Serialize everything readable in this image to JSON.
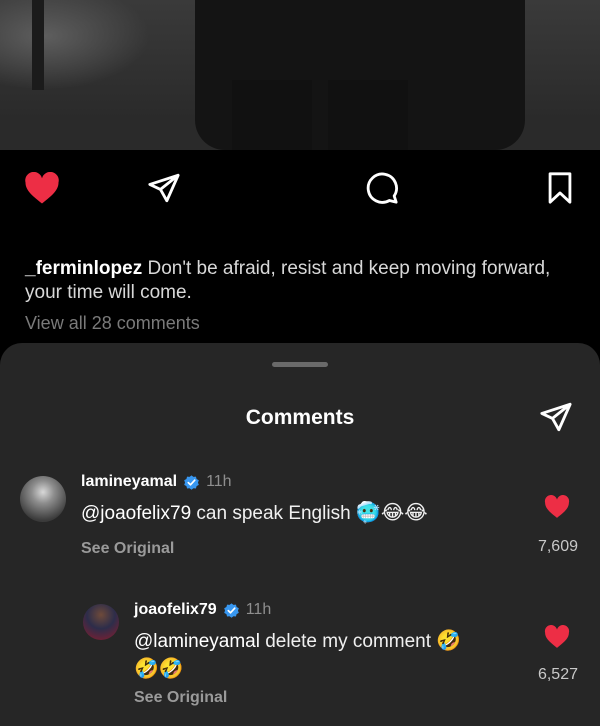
{
  "post": {
    "caption_user": "_ferminlopez",
    "caption_text": "Don't be afraid, resist and keep moving forward, your time will come.",
    "view_all_comments": "View all 28 comments"
  },
  "sheet": {
    "title": "Comments"
  },
  "comments": [
    {
      "username": "lamineyamal",
      "time": "11h",
      "mention": "@joaofelix79",
      "text": "can speak English",
      "emojis": "🥶😂😂",
      "see_original": "See Original",
      "likes": "7,609"
    },
    {
      "username": "joaofelix79",
      "time": "11h",
      "mention": "@lamineyamal",
      "text": "delete my comment",
      "emojis_inline": "🤣",
      "emojis_line2": "🤣🤣",
      "see_original": "See Original",
      "likes": "6,527"
    }
  ],
  "colors": {
    "like_red": "#ed2e45",
    "verified_blue": "#3897f0",
    "sheet_bg": "#262626"
  }
}
